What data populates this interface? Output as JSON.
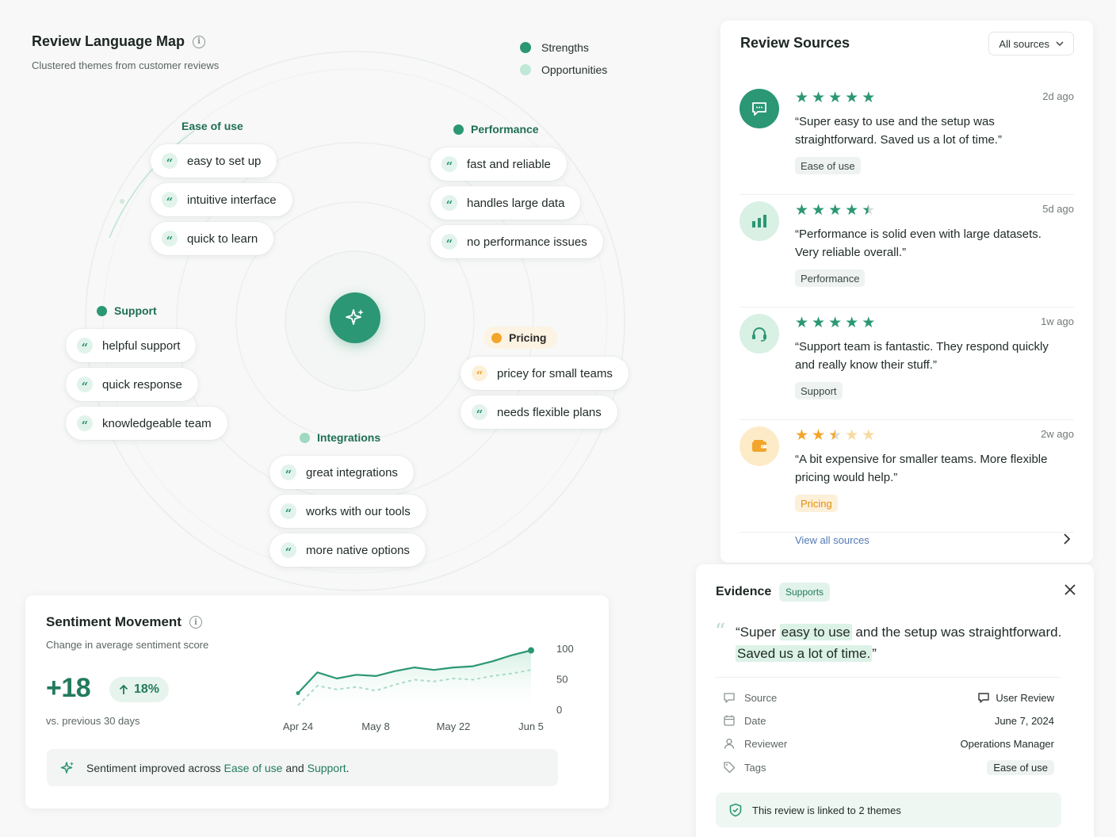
{
  "map": {
    "title": "Review Language Map",
    "subtitle": "Clustered themes from customer reviews",
    "legend": [
      {
        "label": "Strengths",
        "color": "#2b9774"
      },
      {
        "label": "Opportunities",
        "color": "#bfe8d6"
      }
    ],
    "clusters": {
      "ease": {
        "label": "Ease of use",
        "items": [
          "easy to set up",
          "intuitive interface",
          "quick to learn"
        ]
      },
      "performance": {
        "label": "Performance",
        "items": [
          "fast and reliable",
          "handles large data",
          "no performance issues"
        ]
      },
      "support": {
        "label": "Support",
        "items": [
          "helpful support",
          "quick response",
          "knowledgeable team"
        ]
      },
      "pricing": {
        "label": "Pricing",
        "items": [
          "pricey for small teams",
          "needs flexible plans"
        ]
      },
      "integrations": {
        "label": "Integrations",
        "items": [
          "great integrations",
          "works with our tools",
          "more native options"
        ]
      }
    },
    "quote_glyph": "“"
  },
  "sources": {
    "title": "Review Sources",
    "filter": "All sources",
    "reviews": [
      {
        "rating": 5,
        "ago": "2d ago",
        "text": "“Super easy to use and the setup was straightforward. Saved us a lot of time.”",
        "tag": "Ease of use",
        "icon": "chat-icon",
        "accent": "#2b9774"
      },
      {
        "rating": 4.5,
        "ago": "5d ago",
        "text": "“Performance is solid even with large datasets. Very reliable overall.”",
        "tag": "Performance",
        "icon": "bar-chart-icon",
        "accent": "#2b9774"
      },
      {
        "rating": 5,
        "ago": "1w ago",
        "text": "“Support team is fantastic. They respond quickly and really know their stuff.”",
        "tag": "Support",
        "icon": "headset-icon",
        "accent": "#2b9774"
      },
      {
        "rating": 2.5,
        "ago": "2w ago",
        "text": "“A bit expensive for smaller teams. More flexible pricing would help.”",
        "tag": "Pricing",
        "icon": "wallet-icon",
        "accent": "#f2a52a"
      }
    ],
    "view_all": "View all sources"
  },
  "evidence": {
    "title": "Evidence",
    "badge": "Supports",
    "quote_parts": [
      "“Super ",
      "easy to use",
      " and the setup was straightforward. ",
      "Saved us a lot of time.",
      "”"
    ],
    "meta": [
      {
        "key": "Source",
        "value": "User Review",
        "icon": "chat-icon"
      },
      {
        "key": "Date",
        "value": "June 7, 2024",
        "icon": "calendar-icon"
      },
      {
        "key": "Reviewer",
        "value": "Operations Manager",
        "icon": "user-icon"
      },
      {
        "key": "Tags",
        "value": "Ease of use",
        "icon": "tag-icon"
      }
    ],
    "linked": "This review is linked to 2 themes"
  },
  "sentiment": {
    "title": "Sentiment Movement",
    "subtitle": "Change in average sentiment score",
    "delta": "+18",
    "pct": "18%",
    "vs": "vs. previous 30 days",
    "improve_prefix": "Sentiment improved across ",
    "improve_link1": "Ease of use",
    "improve_and": " and ",
    "improve_link2": "Support",
    "improve_suffix": "."
  },
  "chart_data": {
    "type": "line",
    "x": [
      "Apr 24",
      "Apr 28",
      "May 2",
      "May 6",
      "May 8",
      "May 12",
      "May 16",
      "May 20",
      "May 22",
      "May 26",
      "May 30",
      "Jun 3",
      "Jun 5"
    ],
    "x_tick_labels": [
      "Apr 24",
      "May 8",
      "May 22",
      "Jun 5"
    ],
    "ylim": [
      0,
      100
    ],
    "y_ticks": [
      0,
      50,
      100
    ],
    "series": [
      {
        "values": [
          28,
          62,
          52,
          58,
          56,
          64,
          70,
          66,
          70,
          72,
          80,
          90,
          98
        ],
        "style": "solid"
      },
      {
        "values": [
          8,
          40,
          34,
          38,
          32,
          42,
          50,
          47,
          52,
          50,
          56,
          60,
          66
        ],
        "style": "dashed"
      }
    ],
    "grid": false,
    "colors": {
      "line": "#2b9774",
      "dashed": "#a9dcc6"
    }
  }
}
